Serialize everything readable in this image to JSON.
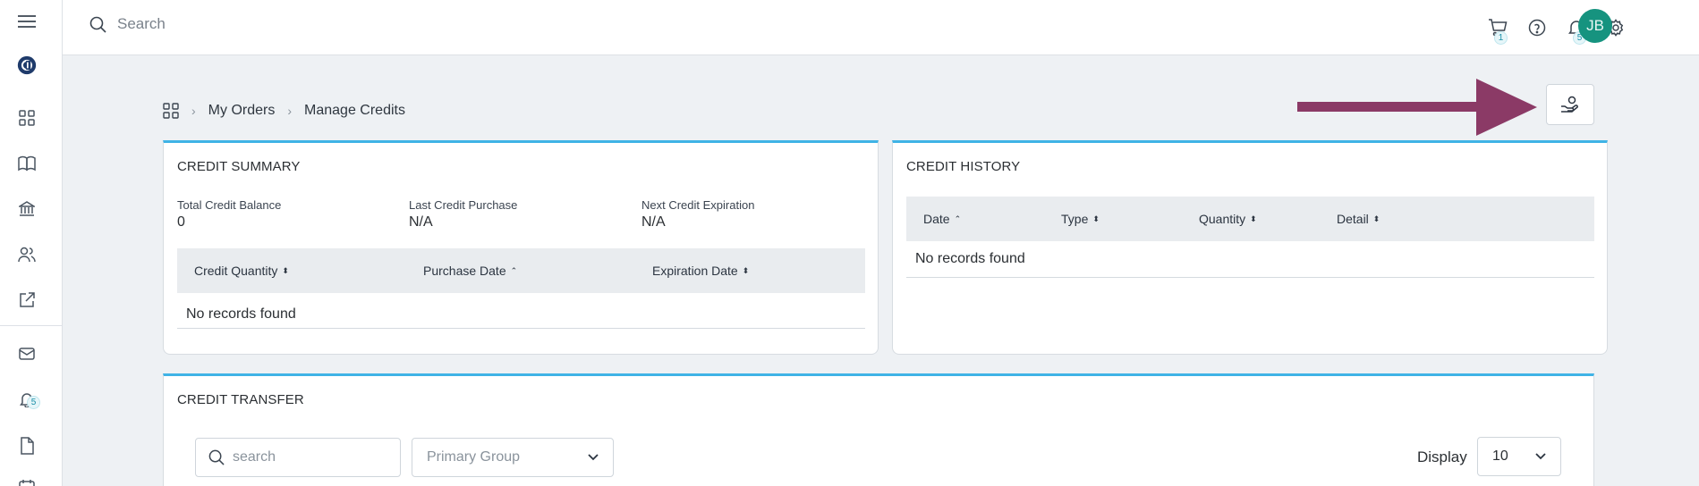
{
  "topbar": {
    "search_placeholder": "Search",
    "cart_count": "1",
    "notifications_count": "5",
    "avatar_initials": "JB"
  },
  "sidebar": {
    "notifications_badge": "5"
  },
  "breadcrumb": {
    "items": [
      "My Orders",
      "Manage Credits"
    ]
  },
  "credit_summary": {
    "title": "CREDIT SUMMARY",
    "total_balance_label": "Total Credit Balance",
    "total_balance_value": "0",
    "last_purchase_label": "Last Credit Purchase",
    "last_purchase_value": "N/A",
    "next_expiration_label": "Next Credit Expiration",
    "next_expiration_value": "N/A",
    "columns": [
      "Credit Quantity",
      "Purchase Date",
      "Expiration Date"
    ],
    "empty_text": "No records found"
  },
  "credit_history": {
    "title": "CREDIT HISTORY",
    "columns": [
      "Date",
      "Type",
      "Quantity",
      "Detail"
    ],
    "empty_text": "No records found"
  },
  "credit_transfer": {
    "title": "CREDIT TRANSFER",
    "search_placeholder": "search",
    "group_select": "Primary Group",
    "display_label": "Display",
    "display_value": "10"
  },
  "colors": {
    "accent": "#3fb3e6",
    "avatar": "#16937f",
    "arrow": "#8b3a66"
  }
}
